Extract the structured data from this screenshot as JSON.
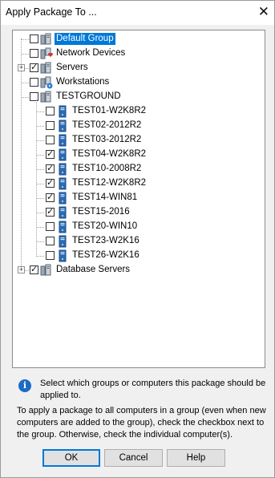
{
  "window": {
    "title": "Apply Package To ...",
    "close_glyph": "✕"
  },
  "tree": {
    "groups": [
      {
        "label": "Default Group",
        "checked": false,
        "selected": true,
        "expandable": false,
        "icon": "group-server-icon"
      },
      {
        "label": "Network Devices",
        "checked": false,
        "selected": false,
        "expandable": false,
        "icon": "network-device-icon"
      },
      {
        "label": "Servers",
        "checked": true,
        "selected": false,
        "expandable": true,
        "expand_glyph": "+",
        "icon": "server-group-icon"
      },
      {
        "label": "Workstations",
        "checked": false,
        "selected": false,
        "expandable": false,
        "icon": "workstation-group-icon"
      },
      {
        "label": "TESTGROUND",
        "checked": false,
        "selected": false,
        "expandable": false,
        "icon": "server-group-icon"
      }
    ],
    "computers": [
      {
        "label": "TEST01-W2K8R2",
        "checked": false
      },
      {
        "label": "TEST02-2012R2",
        "checked": false
      },
      {
        "label": "TEST03-2012R2",
        "checked": false
      },
      {
        "label": "TEST04-W2K8R2",
        "checked": true
      },
      {
        "label": "TEST10-2008R2",
        "checked": true
      },
      {
        "label": "TEST12-W2K8R2",
        "checked": true
      },
      {
        "label": "TEST14-WIN81",
        "checked": true
      },
      {
        "label": "TEST15-2016",
        "checked": true
      },
      {
        "label": "TEST20-WIN10",
        "checked": false
      },
      {
        "label": "TEST23-W2K16",
        "checked": false
      },
      {
        "label": "TEST26-W2K16",
        "checked": false
      }
    ],
    "last_group": {
      "label": "Database Servers",
      "checked": true,
      "expandable": true,
      "expand_glyph": "+",
      "icon": "server-group-icon"
    }
  },
  "info": {
    "icon_glyph": "i",
    "text": "Select which groups or computers this package should be applied to.",
    "description": "To apply a package to all computers in a group (even when new computers are added to the group), check the checkbox next to the group. Otherwise, check the individual computer(s)."
  },
  "buttons": {
    "ok": "OK",
    "cancel": "Cancel",
    "help": "Help"
  },
  "colors": {
    "selection": "#0078d7",
    "info_icon": "#1a6bc6"
  }
}
